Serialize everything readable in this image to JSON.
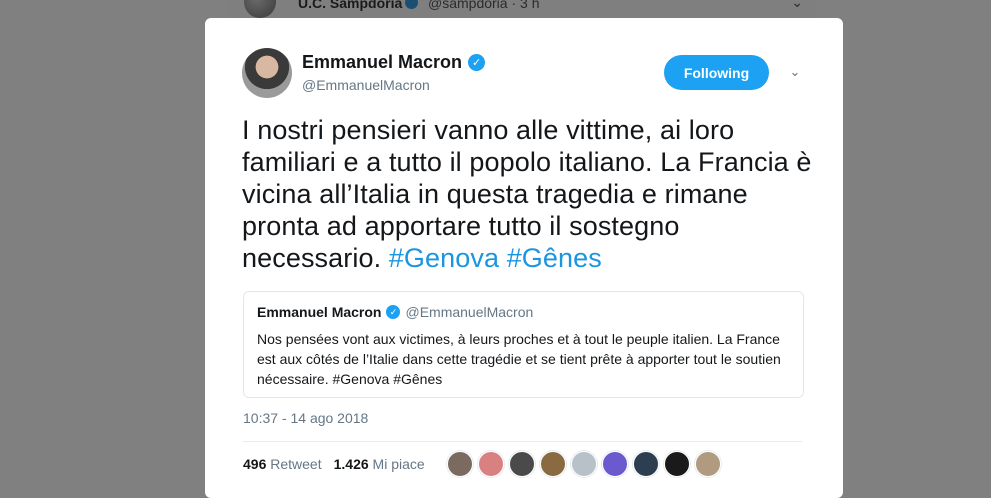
{
  "background_tweet": {
    "name": "U.C. Sampdoria",
    "handle_time": "@sampdoria · 3 h"
  },
  "tweet": {
    "author_name": "Emmanuel Macron",
    "author_handle": "@EmmanuelMacron",
    "follow_label": "Following",
    "text_plain": "I nostri pensieri vanno alle vittime, ai loro familiari e a tutto il popolo italiano. La Francia è vicina all’Italia in questa tragedia e rimane pronta ad apportare tutto il sostegno necessario.",
    "hashtags": [
      "#Genova",
      "#Gênes"
    ],
    "timestamp": "10:37 - 14 ago 2018",
    "retweets_count": "496",
    "retweets_label": "Retweet",
    "likes_count": "1.426",
    "likes_label": "Mi piace"
  },
  "quoted_tweet": {
    "author_name": "Emmanuel Macron",
    "author_handle": "@EmmanuelMacron",
    "text": "Nos pensées vont aux victimes, à leurs proches et à tout le peuple italien. La France est aux côtés de l’Italie dans cette tragédie et se tient prête à apporter tout le soutien nécessaire. #Genova #Gênes"
  },
  "colors": {
    "accent": "#1da1f2",
    "hashtag": "#1b95e0",
    "muted_text": "#657786",
    "overlay": "#808080"
  },
  "icons": [
    "verified-badge-icon",
    "chevron-down-icon"
  ],
  "likers": [
    {
      "color": "#7a6a60"
    },
    {
      "color": "#d98080"
    },
    {
      "color": "#4a4a4a"
    },
    {
      "color": "#8a6a40"
    },
    {
      "color": "#b8c0c8"
    },
    {
      "color": "#6a5acd"
    },
    {
      "color": "#2c3e50"
    },
    {
      "color": "#1a1a1a"
    },
    {
      "color": "#b09a80"
    }
  ]
}
